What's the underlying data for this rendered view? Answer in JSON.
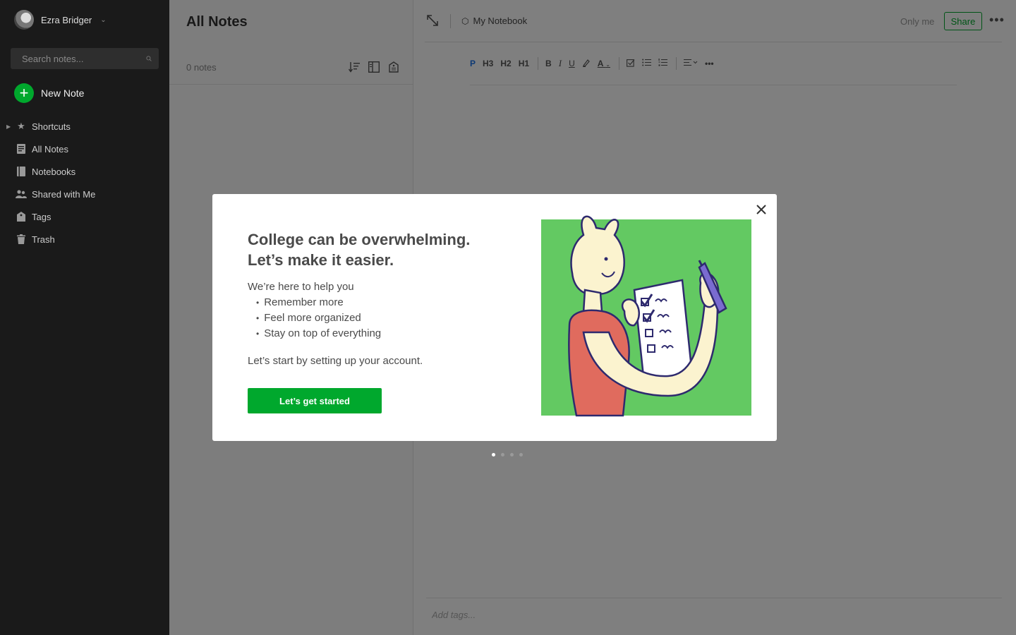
{
  "sidebar": {
    "user_name": "Ezra Bridger",
    "search_placeholder": "Search notes...",
    "new_note_label": "New Note",
    "items": [
      {
        "label": "Shortcuts",
        "icon": "star-icon"
      },
      {
        "label": "All Notes",
        "icon": "note-icon"
      },
      {
        "label": "Notebooks",
        "icon": "notebook-icon"
      },
      {
        "label": "Shared with Me",
        "icon": "people-icon"
      },
      {
        "label": "Tags",
        "icon": "tag-icon"
      },
      {
        "label": "Trash",
        "icon": "trash-icon"
      }
    ]
  },
  "notelist": {
    "title": "All Notes",
    "count": "0 notes"
  },
  "editor": {
    "notebook": "My Notebook",
    "visibility": "Only me",
    "share_label": "Share",
    "toolbar": [
      "P",
      "H3",
      "H2",
      "H1"
    ],
    "tags_placeholder": "Add tags..."
  },
  "modal": {
    "headline_1": "College can be overwhelming.",
    "headline_2": "Let’s make it easier.",
    "intro": "We’re here to help you",
    "bullets": [
      "Remember more",
      "Feel more organized",
      "Stay on top of everything"
    ],
    "closing": "Let’s start by setting up your account.",
    "cta_label": "Let’s get started",
    "illustration_bg": "#63c962"
  },
  "pager": {
    "total": 4,
    "current": 1
  },
  "colors": {
    "brand_green": "#00a82d",
    "sidebar_bg": "#1a1a1a",
    "link_blue": "#1a73e8"
  }
}
